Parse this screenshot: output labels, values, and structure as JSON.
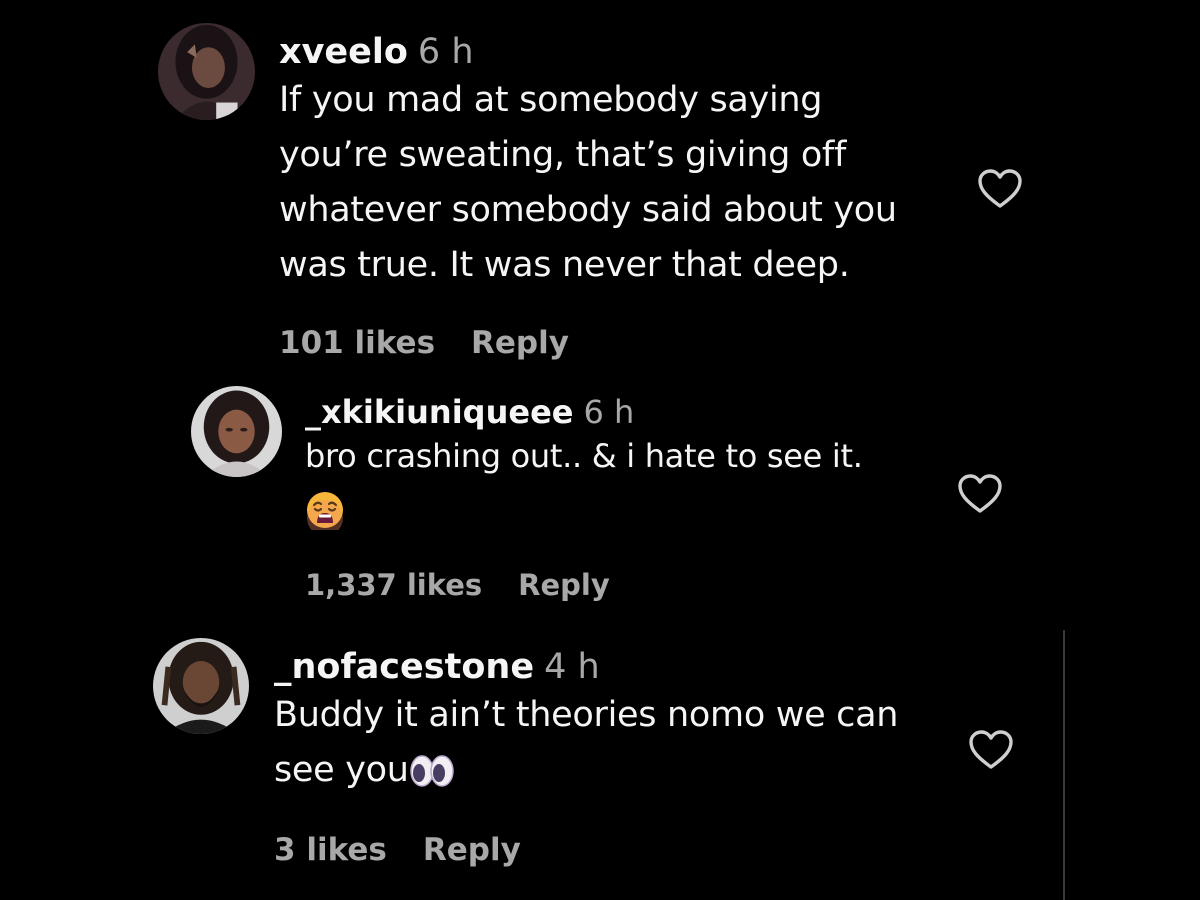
{
  "comments": [
    {
      "username": "xveelo",
      "time": "6 h",
      "text_lines": [
        "If you mad at somebody saying",
        "you’re sweating, that’s giving off",
        "whatever somebody said about you",
        "was true. It was never that deep."
      ],
      "likes": "101 likes",
      "reply_label": "Reply",
      "avatar_icon": "avatar-photo-icon",
      "like_icon": "heart-outline-icon"
    },
    {
      "username": "_xkikiuniqueee",
      "time": "6 h",
      "text_lines": [
        "bro crashing out.. & i hate to see it."
      ],
      "emoji": "weary-face-emoji",
      "likes": "1,337 likes",
      "reply_label": "Reply",
      "avatar_icon": "avatar-photo-icon",
      "like_icon": "heart-outline-icon"
    },
    {
      "username": "_nofacestone",
      "time": "4 h",
      "text_lines": [
        "Buddy it ain’t theories nomo we can",
        "see you"
      ],
      "emoji": "eyes-emoji",
      "likes": "3 likes",
      "reply_label": "Reply",
      "avatar_icon": "avatar-photo-icon",
      "like_icon": "heart-outline-icon"
    }
  ],
  "colors": {
    "background": "#000000",
    "primary_text": "#f5f5f5",
    "secondary_text": "#a8a8a8"
  }
}
